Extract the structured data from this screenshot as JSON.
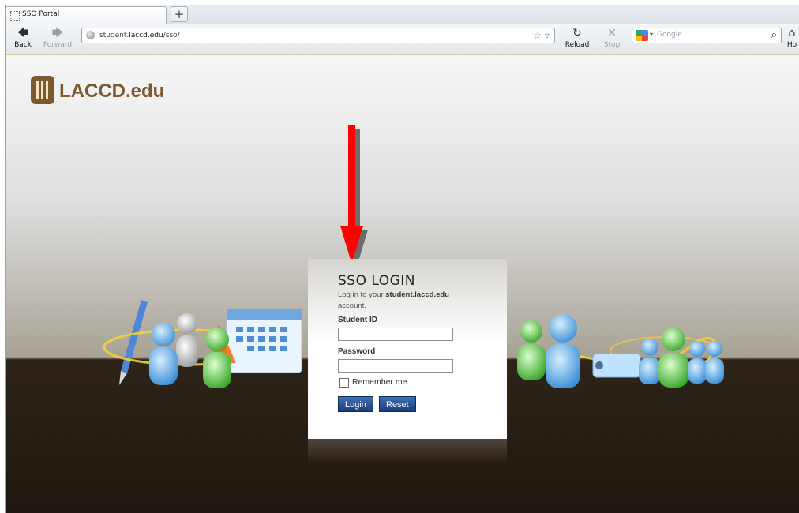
{
  "browser": {
    "tab_title": "SSO Portal",
    "new_tab": "+",
    "nav": {
      "back": "Back",
      "forward": "Forward",
      "reload": "Reload",
      "stop": "Stop",
      "home": "Ho"
    },
    "url_prefix": "student.",
    "url_domain": "laccd.edu",
    "url_path": "/sso/",
    "search_placeholder": "Google"
  },
  "logo": {
    "text": "LACCD.edu",
    "color": "#7a5a2e"
  },
  "login": {
    "title": "SSO LOGIN",
    "subtitle_prefix": "Log in to your ",
    "subtitle_site": "student.laccd.edu",
    "subtitle_suffix": "account.",
    "student_id_label": "Student ID",
    "student_id_value": "",
    "password_label": "Password",
    "password_value": "",
    "remember_label": "Remember me",
    "remember_checked": false,
    "login_button": "Login",
    "reset_button": "Reset"
  },
  "colors": {
    "arrow": "#ff0000",
    "button": "#1a3f7c"
  }
}
